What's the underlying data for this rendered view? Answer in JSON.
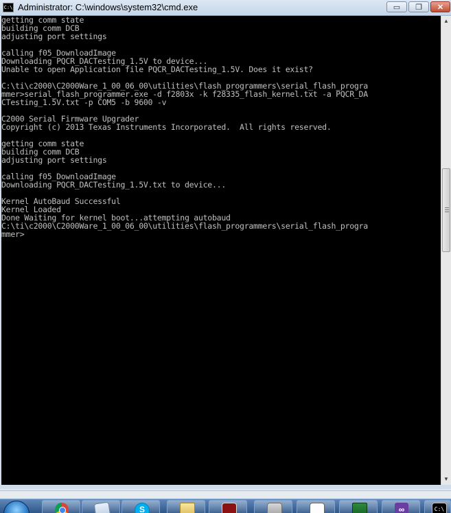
{
  "window": {
    "title": "Administrator: C:\\windows\\system32\\cmd.exe",
    "app_icon_text": "C:\\",
    "minimize_glyph": "▭",
    "maximize_glyph": "❐",
    "close_glyph": "✕"
  },
  "console": {
    "lines": [
      "getting comm state",
      "building comm DCB",
      "adjusting port settings",
      "",
      "calling f05_DownloadImage",
      "Downloading PQCR_DACTesting_1.5V to device...",
      "Unable to open Application file PQCR_DACTesting_1.5V. Does it exist?",
      "",
      "C:\\ti\\c2000\\C2000Ware_1_00_06_00\\utilities\\flash_programmers\\serial_flash_progra",
      "mmer>serial_flash_programmer.exe -d f2803x -k f28335_flash_kernel.txt -a PQCR_DA",
      "CTesting_1.5V.txt -p COM5 -b 9600 -v",
      "",
      "C2000 Serial Firmware Upgrader",
      "Copyright (c) 2013 Texas Instruments Incorporated.  All rights reserved.",
      "",
      "getting comm state",
      "building comm DCB",
      "adjusting port settings",
      "",
      "calling f05_DownloadImage",
      "Downloading PQCR_DACTesting_1.5V.txt to device...",
      "",
      "Kernel AutoBaud Successful",
      "Kernel Loaded",
      "Done Waiting for kernel boot...attempting autobaud",
      "C:\\ti\\c2000\\C2000Ware_1_00_06_00\\utilities\\flash_programmers\\serial_flash_progra",
      "mmer>"
    ]
  },
  "scrollbar": {
    "up_glyph": "▲",
    "down_glyph": "▼"
  },
  "taskbar": {
    "items": [
      {
        "name": "chrome",
        "glyph": ""
      },
      {
        "name": "documents",
        "glyph": ""
      },
      {
        "name": "skype",
        "glyph": "S"
      },
      {
        "name": "explorer",
        "glyph": ""
      },
      {
        "name": "app-red",
        "glyph": ""
      },
      {
        "name": "virtualbox",
        "glyph": ""
      },
      {
        "name": "paint",
        "glyph": ""
      },
      {
        "name": "board-app",
        "glyph": ""
      },
      {
        "name": "visual-studio",
        "glyph": "∞"
      },
      {
        "name": "cmd",
        "glyph": "C:\\"
      }
    ]
  },
  "colors": {
    "console_bg": "#000000",
    "console_fg": "#c0c0c0",
    "titlebar": "#c6d6e8",
    "taskbar": "#2f5688"
  }
}
